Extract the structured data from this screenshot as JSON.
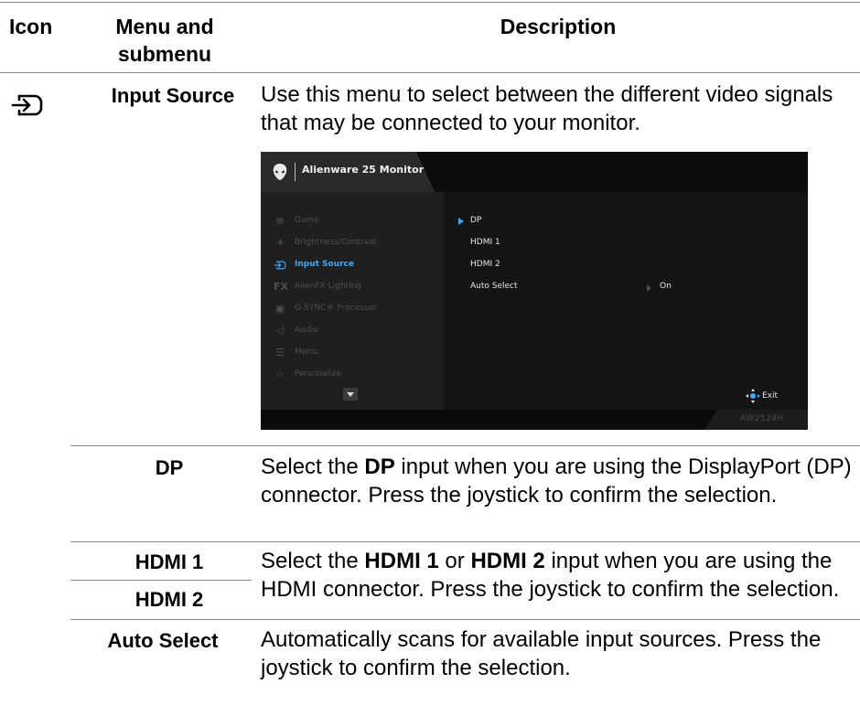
{
  "table": {
    "headers": {
      "icon": "Icon",
      "menu_line1": "Menu and",
      "menu_line2": "submenu",
      "description": "Description"
    },
    "main_row": {
      "icon": "input-source-icon",
      "label": "Input Source",
      "description": "Use this menu to select between the different video signals that may be connected to your monitor."
    },
    "sub_rows": [
      {
        "label": "DP",
        "desc_parts": [
          "Select the ",
          "DP",
          " input when you are using the DisplayPort (DP) connector. Press the joystick to confirm the selection."
        ]
      },
      {
        "labels": [
          "HDMI 1",
          "HDMI 2"
        ],
        "desc_parts": [
          "Select the ",
          "HDMI 1",
          " or ",
          "HDMI 2",
          " input when you are using the HDMI connector. Press the joystick to confirm the selection."
        ]
      },
      {
        "label": "Auto Select",
        "description": "Automatically scans for available input sources. Press the joystick to confirm the selection."
      }
    ]
  },
  "osd": {
    "title": "Alienware 25 Monitor",
    "menu_items": [
      {
        "icon": "gamepad-icon",
        "label": "Game"
      },
      {
        "icon": "brightness-icon",
        "label": "Brightness/Contrast"
      },
      {
        "icon": "input-source-icon",
        "label": "Input Source",
        "active": true
      },
      {
        "icon": "fx-icon",
        "label": "AlienFX Lighting"
      },
      {
        "icon": "processor-icon",
        "label": "G-SYNC® Processor"
      },
      {
        "icon": "speaker-icon",
        "label": "Audio"
      },
      {
        "icon": "menu-icon",
        "label": "Menu"
      },
      {
        "icon": "star-icon",
        "label": "Personalize"
      }
    ],
    "options": [
      "DP",
      "HDMI 1",
      "HDMI 2",
      "Auto Select"
    ],
    "auto_select_value": "On",
    "exit_label": "Exit",
    "model": "AW2524H",
    "accent_color": "#3ba9ff"
  }
}
